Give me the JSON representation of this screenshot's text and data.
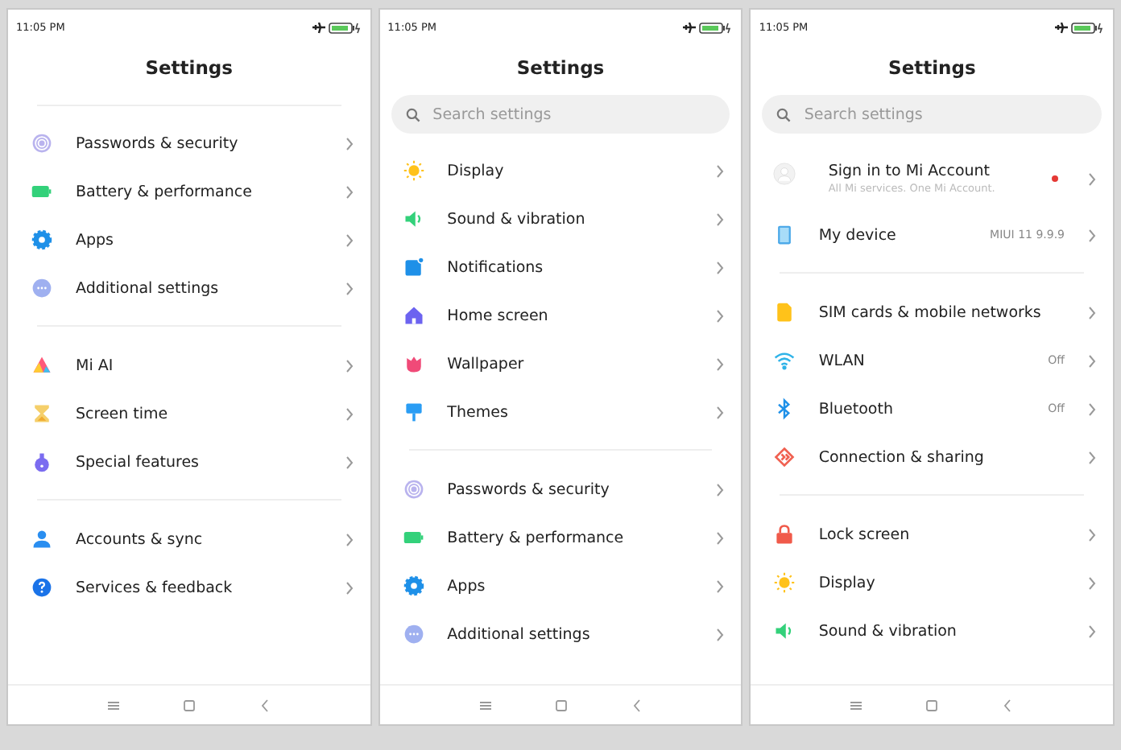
{
  "screens": [
    {
      "time": "11:05 PM",
      "title": "Settings",
      "top_divider": true,
      "groups": [
        {
          "items": [
            {
              "kind": "fingerprint",
              "label": "Passwords & security"
            },
            {
              "kind": "battery",
              "label": "Battery & performance"
            },
            {
              "kind": "gear",
              "label": "Apps"
            },
            {
              "kind": "dots",
              "label": "Additional settings"
            }
          ]
        },
        {
          "items": [
            {
              "kind": "triangle",
              "label": "Mi AI"
            },
            {
              "kind": "hourglass",
              "label": "Screen time"
            },
            {
              "kind": "flask",
              "label": "Special features"
            }
          ]
        },
        {
          "items": [
            {
              "kind": "person",
              "label": "Accounts & sync"
            },
            {
              "kind": "question",
              "label": "Services & feedback"
            }
          ]
        }
      ]
    },
    {
      "time": "11:05 PM",
      "title": "Settings",
      "search": {
        "placeholder": "Search settings"
      },
      "groups": [
        {
          "items": [
            {
              "kind": "sun",
              "label": "Display"
            },
            {
              "kind": "speaker",
              "label": "Sound & vibration"
            },
            {
              "kind": "note",
              "label": "Notifications"
            },
            {
              "kind": "house",
              "label": "Home screen"
            },
            {
              "kind": "flower",
              "label": "Wallpaper"
            },
            {
              "kind": "brush",
              "label": "Themes"
            }
          ]
        },
        {
          "items": [
            {
              "kind": "fingerprint",
              "label": "Passwords & security"
            },
            {
              "kind": "battery",
              "label": "Battery & performance"
            },
            {
              "kind": "gear",
              "label": "Apps"
            },
            {
              "kind": "dots",
              "label": "Additional settings"
            }
          ]
        }
      ]
    },
    {
      "time": "11:05 PM",
      "title": "Settings",
      "search": {
        "placeholder": "Search settings"
      },
      "groups": [
        {
          "items": [
            {
              "kind": "avatar",
              "label": "Sign in to Mi Account",
              "subtitle": "All Mi services. One Mi Account.",
              "badge": true
            },
            {
              "kind": "phone",
              "label": "My device",
              "value": "MIUI 11 9.9.9"
            }
          ]
        },
        {
          "items": [
            {
              "kind": "sim",
              "label": "SIM cards & mobile networks"
            },
            {
              "kind": "wifi",
              "label": "WLAN",
              "value": "Off"
            },
            {
              "kind": "bluetooth",
              "label": "Bluetooth",
              "value": "Off"
            },
            {
              "kind": "share",
              "label": "Connection & sharing"
            }
          ]
        },
        {
          "items": [
            {
              "kind": "lock",
              "label": "Lock screen"
            },
            {
              "kind": "sun",
              "label": "Display"
            },
            {
              "kind": "speaker",
              "label": "Sound & vibration"
            }
          ]
        }
      ]
    }
  ]
}
